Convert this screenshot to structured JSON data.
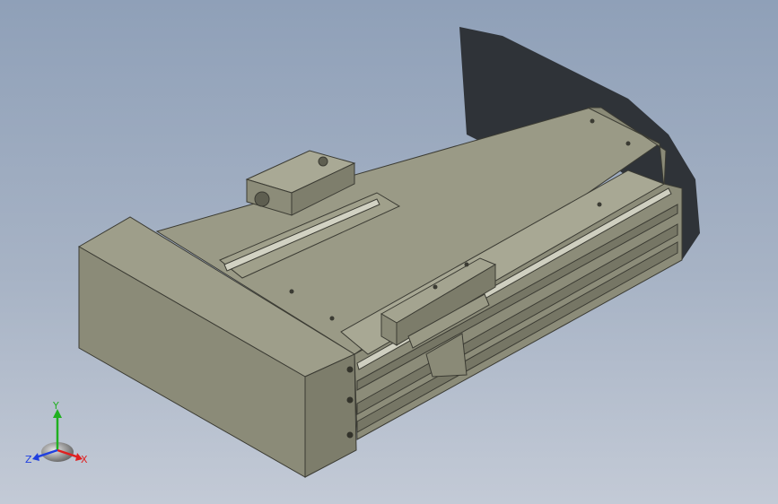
{
  "view": {
    "background_top": "#8fa0b8",
    "background_bottom": "#c3cad6",
    "model_color": "#8d8d7a",
    "shadow_color": "#2f3338"
  },
  "triad": {
    "x_label": "X",
    "y_label": "Y",
    "z_label": "Z",
    "x_color": "#e02020",
    "y_color": "#20b020",
    "z_color": "#2040e0"
  }
}
